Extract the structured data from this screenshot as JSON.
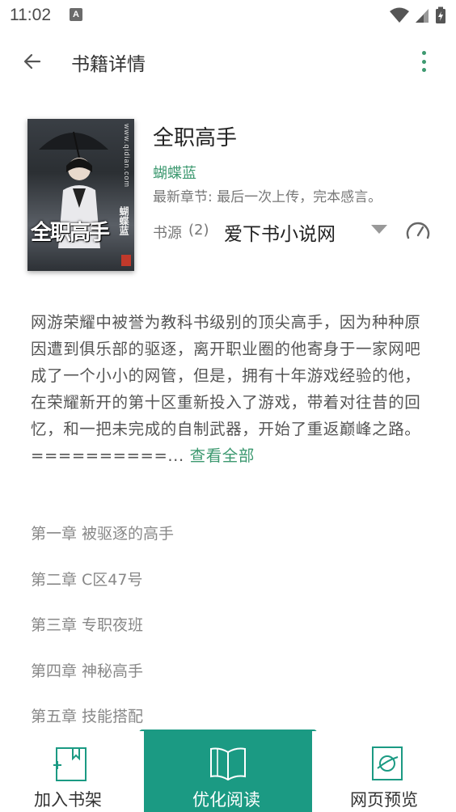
{
  "status_bar": {
    "time": "11:02",
    "notification_letter": "A"
  },
  "app_bar": {
    "title": "书籍详情"
  },
  "book": {
    "cover_title": "全职高手",
    "cover_author": "蝴蝶蓝",
    "cover_site": "www.qidian.com",
    "title": "全职高手",
    "author": "蝴蝶蓝",
    "latest_chapter_label": "最新章节: ",
    "latest_chapter": "最后一次上传，完本感言。",
    "source_label": "书源",
    "source_count": "(2)",
    "source_name": "爱下书小说网",
    "intro": "网游荣耀中被誉为教科书级别的顶尖高手，因为种种原因遭到俱乐部的驱逐，离开职业圈的他寄身于一家网吧成了一个小小的网管，但是，拥有十年游戏经验的他，在荣耀新开的第十区重新投入了游戏，带着对往昔的回忆，和一把未完成的自制武器，开始了重返巅峰之路。==========... ",
    "intro_more": "查看全部"
  },
  "chapters": [
    "第一章 被驱逐的高手",
    "第二章 C区47号",
    "第三章 专职夜班",
    "第四章 神秘高手",
    "第五章 技能搭配"
  ],
  "bottom_bar": {
    "add_shelf": "加入书架",
    "read": "优化阅读",
    "web_preview": "网页预览"
  },
  "colors": {
    "accent": "#3d9970",
    "read_button": "#1b9a83"
  }
}
